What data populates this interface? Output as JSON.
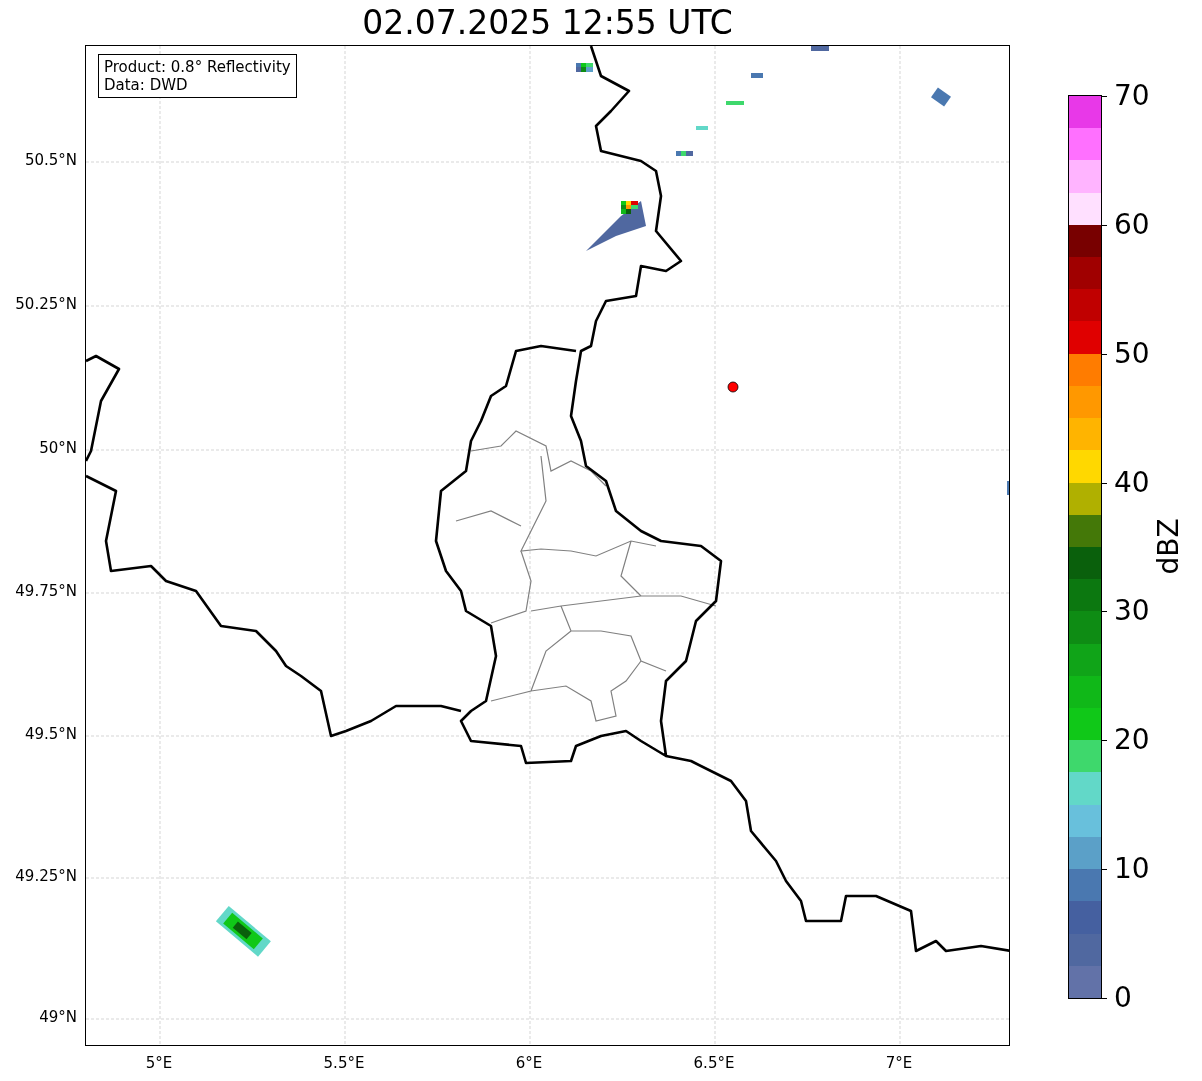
{
  "title": "02.07.2025 12:55 UTC",
  "info_box": [
    "Product: 0.8° Reflectivity",
    "Data: DWD"
  ],
  "x_ticks": [
    "5°E",
    "5.5°E",
    "6°E",
    "6.5°E",
    "7°E"
  ],
  "y_ticks": [
    "50.5°N",
    "50.25°N",
    "50°N",
    "49.75°N",
    "49.5°N",
    "49.25°N",
    "49°N"
  ],
  "colorbar": {
    "label": "dBZ",
    "ticks": [
      "70",
      "60",
      "50",
      "40",
      "30",
      "20",
      "10",
      "0"
    ],
    "bins": [
      {
        "color": "#6272a8"
      },
      {
        "color": "#5068a0"
      },
      {
        "color": "#4560a0"
      },
      {
        "color": "#4a78b0"
      },
      {
        "color": "#5ba0c8"
      },
      {
        "color": "#68c0dc"
      },
      {
        "color": "#62d8c8"
      },
      {
        "color": "#3ed86c"
      },
      {
        "color": "#10c818"
      },
      {
        "color": "#10b818"
      },
      {
        "color": "#10a418"
      },
      {
        "color": "#0e8c14"
      },
      {
        "color": "#0c7810"
      },
      {
        "color": "#0a600c"
      },
      {
        "color": "#447808"
      },
      {
        "color": "#b0b000"
      },
      {
        "color": "#ffd800"
      },
      {
        "color": "#ffb400"
      },
      {
        "color": "#ff9800"
      },
      {
        "color": "#ff7c00"
      },
      {
        "color": "#e00000"
      },
      {
        "color": "#c00000"
      },
      {
        "color": "#a00000"
      },
      {
        "color": "#780000"
      },
      {
        "color": "#ffe0ff"
      },
      {
        "color": "#ffb4ff"
      },
      {
        "color": "#ff70ff"
      },
      {
        "color": "#e838e8"
      }
    ]
  }
}
